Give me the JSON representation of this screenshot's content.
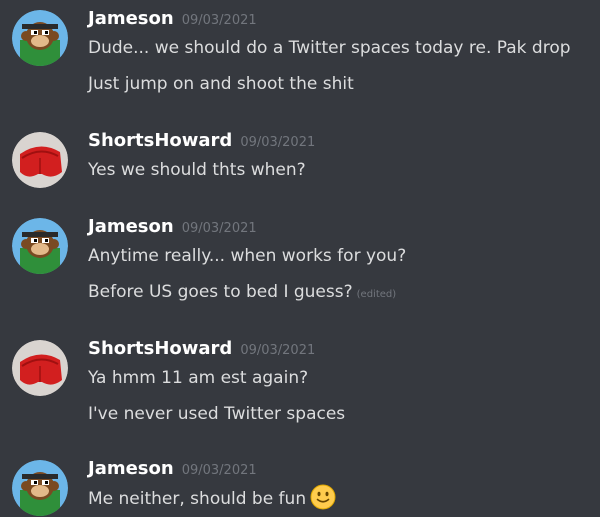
{
  "messages": [
    {
      "author": "Jameson",
      "timestamp": "09/03/2021",
      "avatar_icon": "monkey-avatar-icon",
      "lines": [
        {
          "text": "Dude... we should do a Twitter spaces today re. Pak drop"
        },
        {
          "text": "Just jump on and shoot the shit"
        }
      ]
    },
    {
      "author": "ShortsHoward",
      "timestamp": "09/03/2021",
      "avatar_icon": "red-shorts-avatar-icon",
      "lines": [
        {
          "text": "Yes we should thts when?"
        }
      ]
    },
    {
      "author": "Jameson",
      "timestamp": "09/03/2021",
      "avatar_icon": "monkey-avatar-icon",
      "lines": [
        {
          "text": "Anytime really... when works for you?"
        },
        {
          "text": "Before US goes to bed I guess?",
          "edited": "(edited)"
        }
      ]
    },
    {
      "author": "ShortsHoward",
      "timestamp": "09/03/2021",
      "avatar_icon": "red-shorts-avatar-icon",
      "lines": [
        {
          "text": "Ya hmm 11 am est again?"
        },
        {
          "text": "I've never used Twitter spaces"
        }
      ]
    },
    {
      "author": "Jameson",
      "timestamp": "09/03/2021",
      "avatar_icon": "monkey-avatar-icon",
      "lines": [
        {
          "text": "Me neither, should be fun",
          "emoji": "slightly-smiling-face-emoji"
        }
      ]
    }
  ],
  "colors": {
    "background": "#36393f",
    "username": "#ffffff",
    "timestamp": "#72767d",
    "message_text": "#dcddde",
    "emoji_yellow": "#ffcc4d"
  }
}
